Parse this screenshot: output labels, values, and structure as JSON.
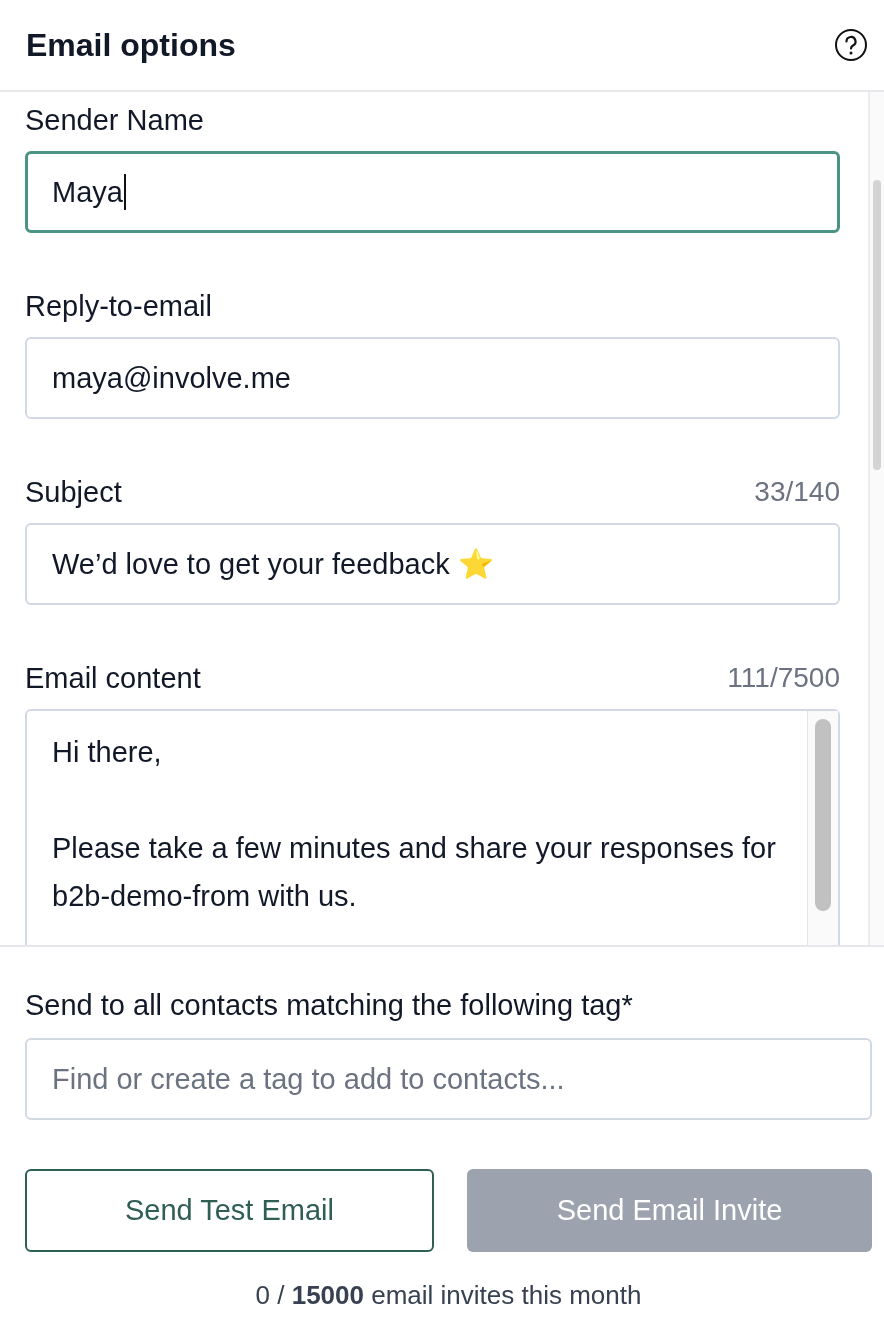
{
  "header": {
    "title": "Email options"
  },
  "fields": [
    {
      "kind": "input",
      "label": "Sender Name",
      "value": "Maya",
      "focused": true
    },
    {
      "kind": "input",
      "label": "Reply-to-email",
      "value": "maya@involve.me",
      "focused": false
    },
    {
      "kind": "input",
      "label": "Subject",
      "counter": "33/140",
      "value": "We’d love to get your feedback ⭐",
      "focused": false
    },
    {
      "kind": "textarea",
      "label": "Email content",
      "counter": "111/7500",
      "value": "Hi there,\n\nPlease take a few minutes and share your responses for b2b-demo-from with us.",
      "focused": false
    }
  ],
  "tag": {
    "label": "Send to all contacts matching the following tag*",
    "placeholder": "Find or create a tag to add to contacts..."
  },
  "buttons": [
    {
      "label": "Send Test Email",
      "disabled": false,
      "kind": "outline"
    },
    {
      "label": "Send Email Invite",
      "disabled": true,
      "kind": "filled"
    }
  ],
  "footer": "0 / **15000** email invites this month"
}
